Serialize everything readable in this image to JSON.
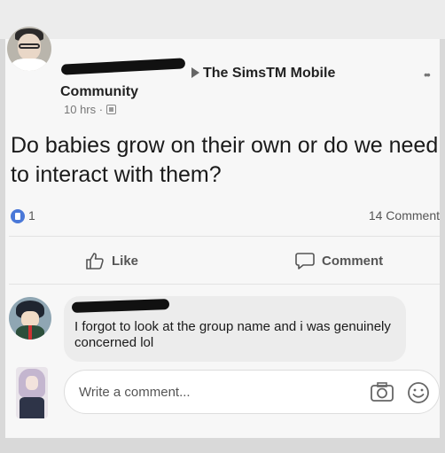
{
  "post": {
    "group_name": "The SimsTM Mobile",
    "group_suffix": "Community",
    "time": "10 hrs ·",
    "body": "Do babies grow on their own or do we need to interact with them?",
    "like_count": "1",
    "comment_count": "14 Comment"
  },
  "actions": {
    "like_label": "Like",
    "comment_label": "Comment"
  },
  "comment": {
    "text": "I forgot to look at the group name and i was genuinely concerned lol"
  },
  "composer": {
    "placeholder": "Write a comment..."
  },
  "icons": {
    "post_avatar": "user-avatar-icon",
    "more": "more-options-icon",
    "privacy": "group-privacy-icon",
    "like_badge": "like-reaction-icon",
    "like": "thumbs-up-icon",
    "comment": "comment-bubble-icon",
    "camera": "camera-icon",
    "emoji": "smiley-icon"
  },
  "colors": {
    "like_blue": "#4a78d8",
    "text": "#1a1a1a",
    "muted": "#777777"
  }
}
